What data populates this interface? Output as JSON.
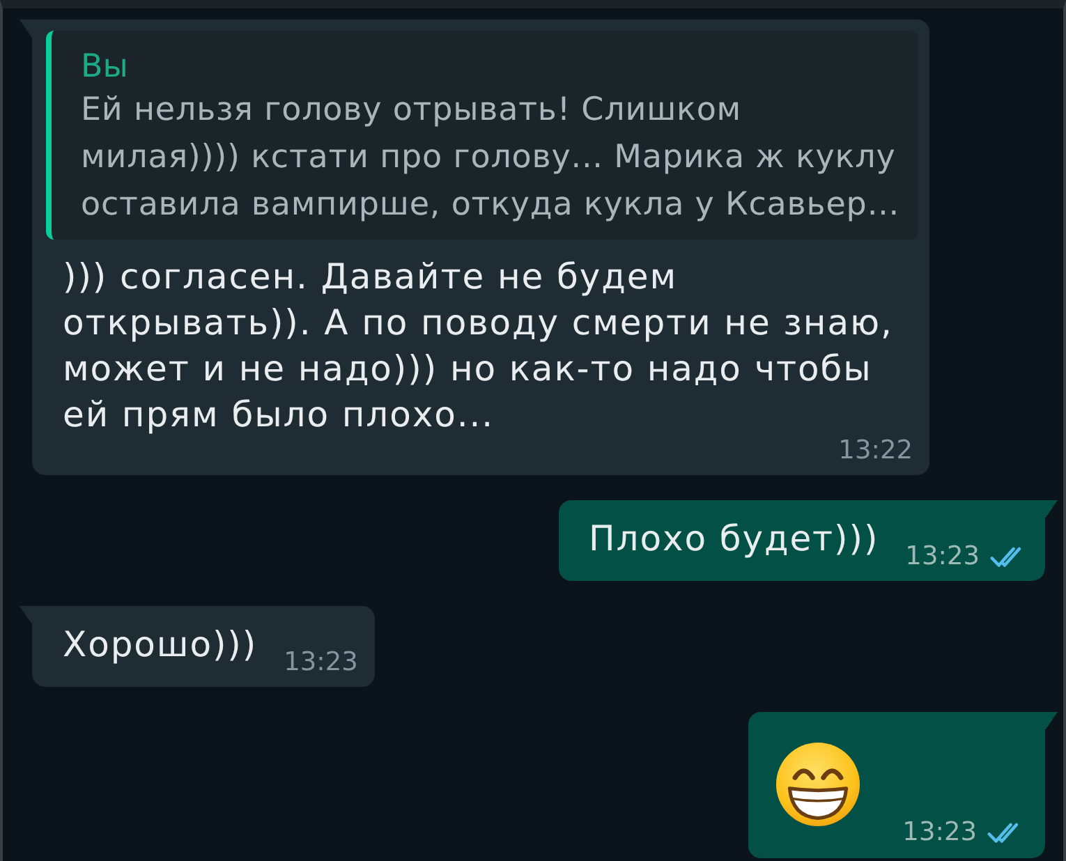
{
  "messages": [
    {
      "kind": "text",
      "outgoing": false,
      "reply": {
        "author": "Вы",
        "text": "Ей нельзя голову отрывать! Слишком милая)))) кстати про голову... Марика ж куклу оставила вампирше, откуда кукла у Ксавьер…"
      },
      "text": "))) согласен. Давайте не будем открывать)). А по поводу смерти не знаю, может и не надо))) но как-то надо чтобы ей прям было плохо...",
      "time": "13:22"
    },
    {
      "kind": "text",
      "outgoing": true,
      "text": "Плохо будет)))",
      "time": "13:23",
      "read": true
    },
    {
      "kind": "text",
      "outgoing": false,
      "text": "Хорошо)))",
      "time": "13:23"
    },
    {
      "kind": "emoji",
      "outgoing": true,
      "time": "13:23",
      "read": true
    }
  ]
}
